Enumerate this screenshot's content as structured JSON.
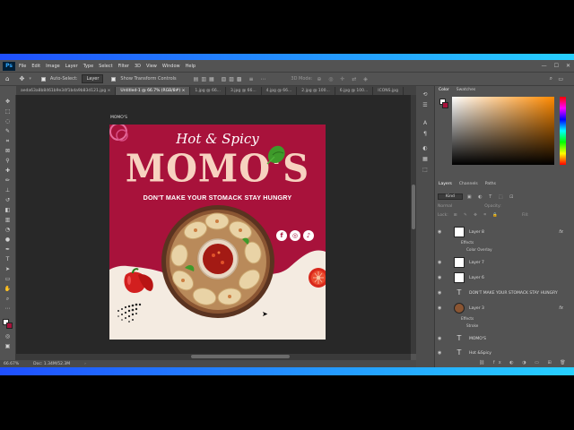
{
  "menu": {
    "logo": "Ps",
    "items": [
      "File",
      "Edit",
      "Image",
      "Layer",
      "Type",
      "Select",
      "Filter",
      "3D",
      "View",
      "Window",
      "Help"
    ],
    "window_controls": [
      "—",
      "☐",
      "✕"
    ]
  },
  "options": {
    "auto_select_label": "Auto-Select:",
    "layer_select": "Layer",
    "transform_label": "Show Transform Controls",
    "mode_3d_label": "3D Mode:"
  },
  "tabs": [
    {
      "label": "aeda63a8b8461b9e34f1bda9b83d121.jpg"
    },
    {
      "label": "Untitled-1 @ 66.7% (RGB/8#)",
      "active": true
    },
    {
      "label": "1.jpg @ 66..."
    },
    {
      "label": "3.jpg @ 66..."
    },
    {
      "label": "4.jpg @ 66..."
    },
    {
      "label": "2.jpg @ 100..."
    },
    {
      "label": "6.jpg @ 100..."
    },
    {
      "label": "ICONS.jpg"
    }
  ],
  "document": {
    "label": "MOMO'S",
    "zoom": "66.67%",
    "doc_size": "Doc: 1.34M/52.3M"
  },
  "poster": {
    "tagline": "Hot & Spicy",
    "brand": "MOMO'S",
    "slogan": "DON'T MAKE YOUR STOMACK STAY HUNGRY",
    "social_icons": [
      "facebook-icon",
      "instagram-icon",
      "tiktok-icon"
    ],
    "colors": {
      "brand_red": "#a8123b",
      "cream": "#f4ebe1",
      "title_peach": "#f7d2c0"
    }
  },
  "right_panel": {
    "color_tabs": [
      "Color",
      "Swatches"
    ],
    "layer_tabs": [
      "Layers",
      "Channels",
      "Paths"
    ],
    "kind_label": "Kind",
    "blend_mode": "Normal",
    "opacity_label": "Opacity:",
    "lock_label": "Lock:",
    "fill_label": "Fill:",
    "layers": [
      {
        "name": "Layer 8",
        "type": "image",
        "fx": true,
        "effects": [
          "Effects",
          "Color Overlay"
        ]
      },
      {
        "name": "Layer 7",
        "type": "image"
      },
      {
        "name": "Layer 6",
        "type": "image"
      },
      {
        "name": "DON'T MAKE YOUR STOMACK STAY HUNGRY",
        "type": "text"
      },
      {
        "name": "Layer 3",
        "type": "image",
        "fx": true,
        "effects": [
          "Effects",
          "Stroke"
        ]
      },
      {
        "name": "MOMO'S",
        "type": "text"
      },
      {
        "name": "Hot &Spicy",
        "type": "text"
      }
    ]
  }
}
